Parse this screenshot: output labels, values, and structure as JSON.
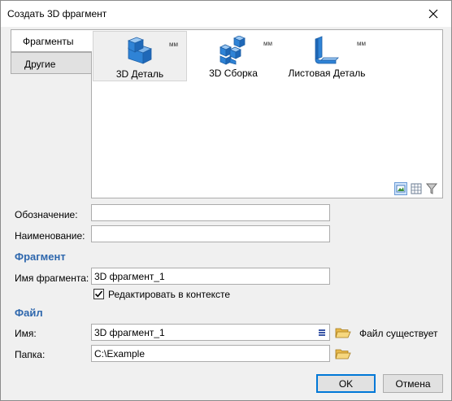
{
  "window": {
    "title": "Создать 3D фрагмент"
  },
  "tabs": [
    {
      "label": "Фрагменты",
      "active": true
    },
    {
      "label": "Другие",
      "active": false
    }
  ],
  "templates": [
    {
      "label": "3D Деталь",
      "unit": "мм",
      "icon": "part-icon",
      "selected": true
    },
    {
      "label": "3D Сборка",
      "unit": "мм",
      "icon": "assembly-icon",
      "selected": false
    },
    {
      "label": "Листовая Деталь",
      "unit": "мм",
      "icon": "sheet-metal-icon",
      "selected": false
    }
  ],
  "view_modes": [
    "large-icons-view-icon",
    "table-view-icon",
    "filter-icon"
  ],
  "form": {
    "designation_label": "Обозначение:",
    "designation_value": "",
    "name_label": "Наименование:",
    "name_value": ""
  },
  "fragment": {
    "heading": "Фрагмент",
    "name_label": "Имя фрагмента:",
    "name_value": "3D фрагмент_1",
    "edit_in_context_label": "Редактировать в контексте",
    "edit_in_context_checked": true
  },
  "file": {
    "heading": "Файл",
    "name_label": "Имя:",
    "name_value": "3D фрагмент_1",
    "exists_status": "Файл существует",
    "folder_label": "Папка:",
    "folder_value": "C:\\Example"
  },
  "buttons": {
    "ok": "OK",
    "cancel": "Отмена"
  },
  "colors": {
    "accent": "#2e67ad",
    "icon_blue": "#2f83d6",
    "default_button_border": "#0078d7"
  }
}
